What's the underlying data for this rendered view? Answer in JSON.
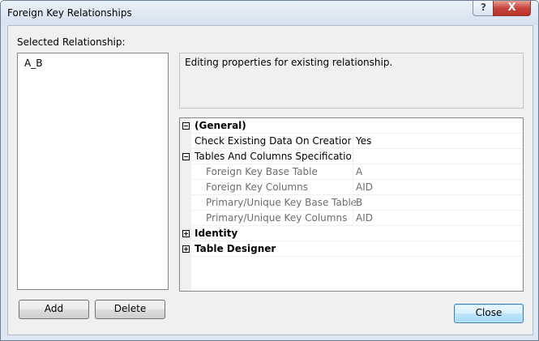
{
  "window": {
    "title": "Foreign Key Relationships",
    "help_label": "?",
    "close_label": "X"
  },
  "left_panel": {
    "label": "Selected Relationship:",
    "items": [
      "A_B"
    ]
  },
  "description": "Editing properties for existing relationship.",
  "property_grid": {
    "rows": [
      {
        "kind": "category",
        "expanded": true,
        "name": "(General)",
        "value": ""
      },
      {
        "kind": "property",
        "name": "Check Existing Data On Creation Or Re-Enabling",
        "value": "Yes"
      },
      {
        "kind": "group",
        "expanded": true,
        "name": "Tables And Columns Specification",
        "value": ""
      },
      {
        "kind": "sub",
        "name": "Foreign Key Base Table",
        "value": "A"
      },
      {
        "kind": "sub",
        "name": "Foreign Key Columns",
        "value": "AID"
      },
      {
        "kind": "sub",
        "name": "Primary/Unique Key Base Table",
        "value": "B"
      },
      {
        "kind": "sub",
        "name": "Primary/Unique Key Columns",
        "value": "AID"
      },
      {
        "kind": "category",
        "expanded": false,
        "name": "Identity",
        "value": ""
      },
      {
        "kind": "category",
        "expanded": false,
        "name": "Table Designer",
        "value": ""
      }
    ]
  },
  "buttons": {
    "add": "Add",
    "delete": "Delete",
    "close": "Close"
  }
}
